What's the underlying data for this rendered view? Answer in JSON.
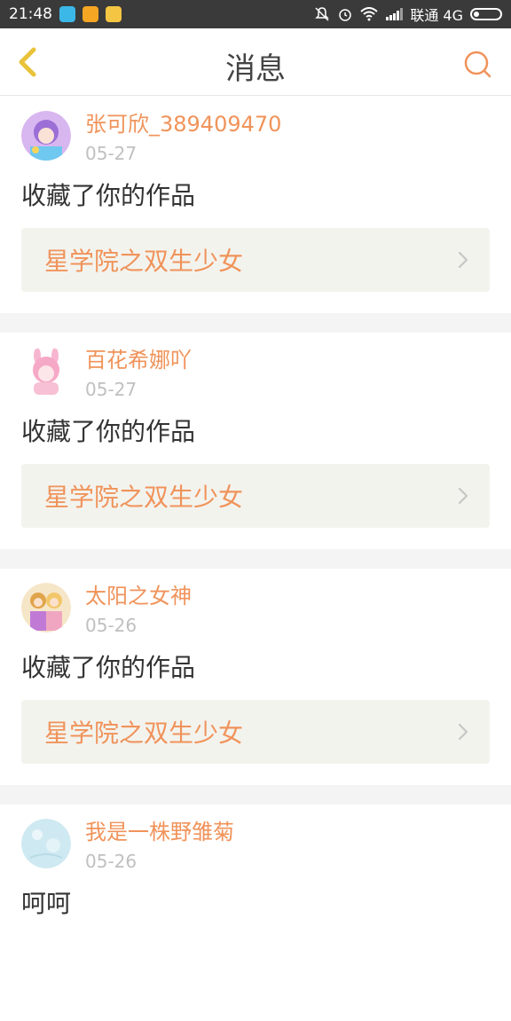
{
  "status_bar": {
    "time": "21:48",
    "carrier": "联通 4G"
  },
  "header": {
    "title": "消息"
  },
  "messages": [
    {
      "username": "张可欣_389409470",
      "date": "05-27",
      "action": "收藏了你的作品",
      "work_title": "星学院之双生少女"
    },
    {
      "username": "百花希娜吖",
      "date": "05-27",
      "action": "收藏了你的作品",
      "work_title": "星学院之双生少女"
    },
    {
      "username": "太阳之女神",
      "date": "05-26",
      "action": "收藏了你的作品",
      "work_title": "星学院之双生少女"
    },
    {
      "username": "我是一株野雏菊",
      "date": "05-26",
      "action": "呵呵"
    }
  ],
  "colors": {
    "accent": "#f0935a",
    "back_arrow": "#e8c33a",
    "status_bar": "#3a3a3a",
    "link_bg": "#f3f3ee"
  }
}
